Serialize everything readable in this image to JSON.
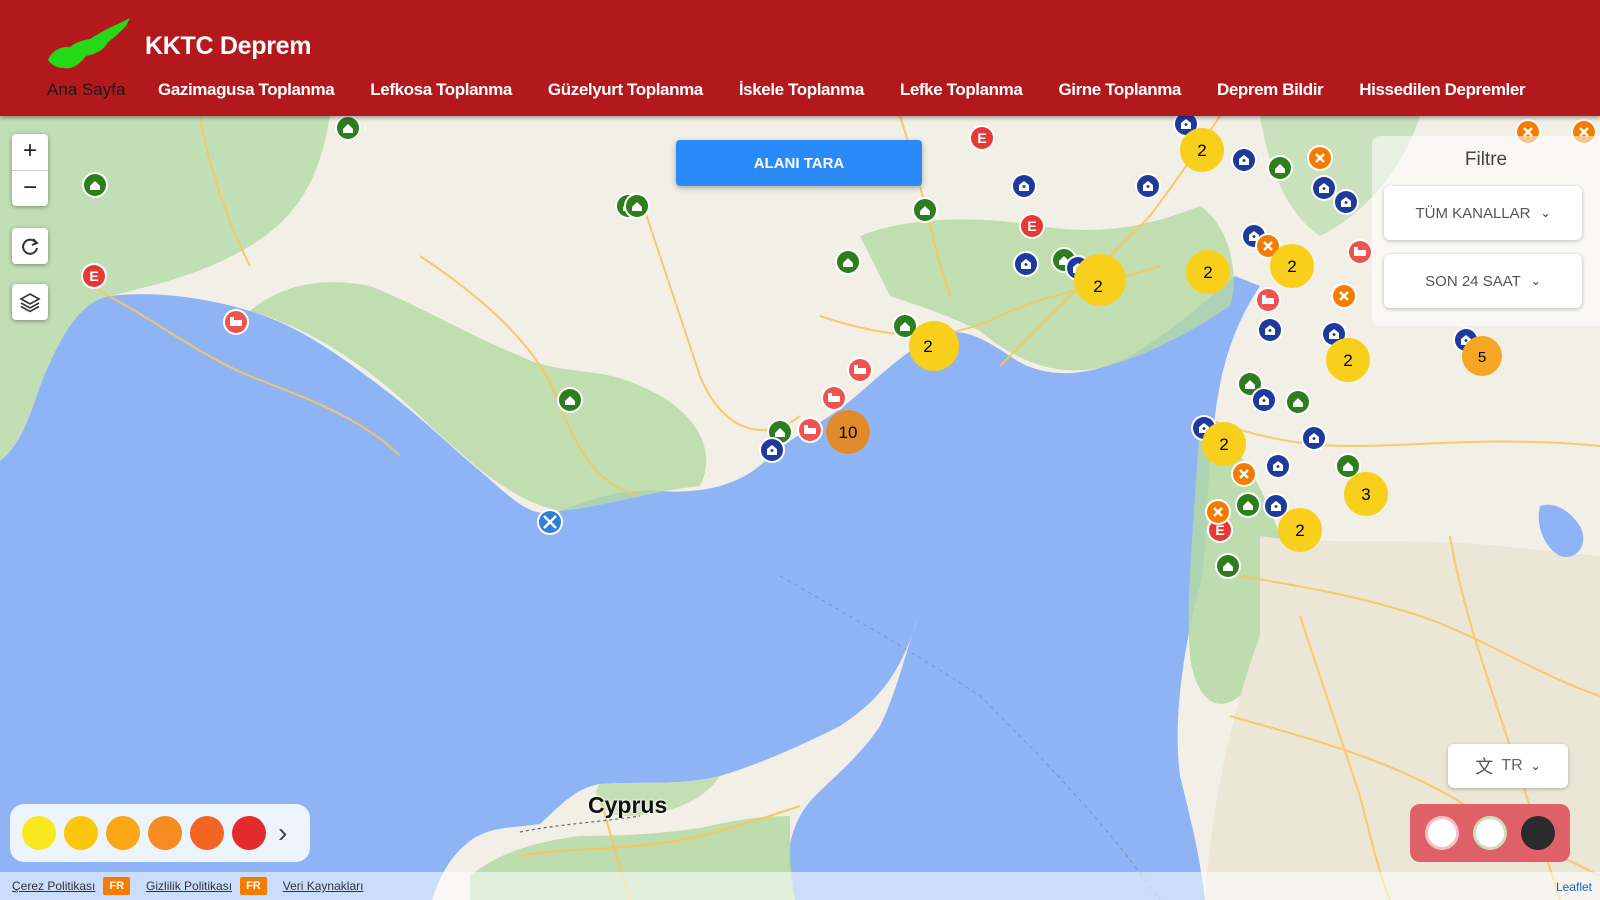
{
  "app": {
    "brand": "KKTC Deprem",
    "home_label": "Ana Sayfa"
  },
  "nav": [
    {
      "label": "Gazimagusa Toplanma"
    },
    {
      "label": "Lefkosa Toplanma"
    },
    {
      "label": "Güzelyurt Toplanma"
    },
    {
      "label": "İskele Toplanma"
    },
    {
      "label": "Lefke Toplanma"
    },
    {
      "label": "Girne Toplanma"
    },
    {
      "label": "Deprem Bildir"
    },
    {
      "label": "Hissedilen Depremler"
    }
  ],
  "map": {
    "scan_button": "ALANI TARA",
    "zoom_in": "+",
    "zoom_out": "−",
    "place_label": "Cyprus",
    "attribution": "Leaflet"
  },
  "filter": {
    "title": "Filtre",
    "channel_select": "TÜM KANALLAR",
    "time_select": "SON 24 SAAT"
  },
  "language": {
    "value": "TR"
  },
  "legend": {
    "colors": [
      "#f9e81f",
      "#fbc70e",
      "#f9a814",
      "#f68b1f",
      "#f26522",
      "#e42b2b"
    ]
  },
  "footer": {
    "cookie_policy": "Çerez Politikası",
    "privacy_policy": "Gizlilik Politikası",
    "data_sources": "Veri Kaynakları",
    "badge": "FR"
  },
  "clusters": [
    {
      "label": "2",
      "color": "#f8cf1a"
    },
    {
      "label": "2",
      "color": "#f8cf1a"
    },
    {
      "label": "2",
      "color": "#f8cf1a"
    },
    {
      "label": "2",
      "color": "#f8cf1a"
    },
    {
      "label": "2",
      "color": "#f8cf1a"
    },
    {
      "label": "2",
      "color": "#f8cf1a"
    },
    {
      "label": "2",
      "color": "#f8cf1a"
    },
    {
      "label": "2",
      "color": "#f8cf1a"
    },
    {
      "label": "3",
      "color": "#f8cf1a"
    },
    {
      "label": "10",
      "color": "#e08a2a"
    },
    {
      "label": "5",
      "color": "#f5a623"
    }
  ],
  "marker_icons": {
    "shelter": "home-icon",
    "hospital": "hospital-icon",
    "emergency": "emergency-icon",
    "bed": "bed-icon",
    "airport": "airport-icon"
  }
}
